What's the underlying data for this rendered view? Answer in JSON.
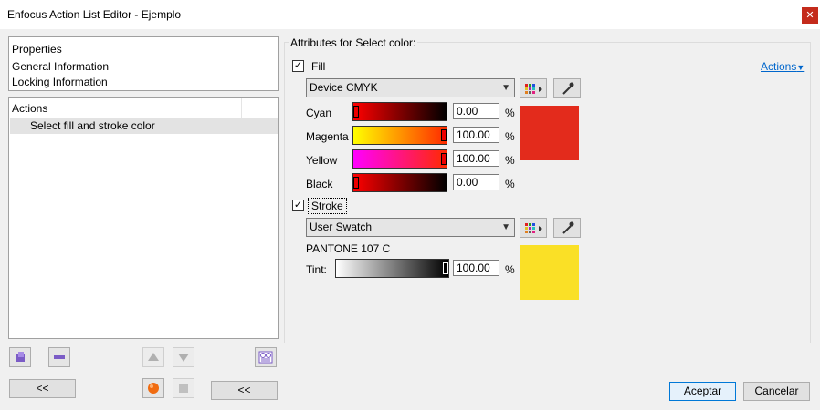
{
  "window": {
    "title": "Enfocus Action List Editor - Ejemplo",
    "close_icon": "close-icon"
  },
  "properties": {
    "header": "Properties",
    "items": [
      "General Information",
      "Locking Information"
    ]
  },
  "actions": {
    "header": "Actions",
    "items": [
      "Select fill and stroke color"
    ]
  },
  "buttons": {
    "back1": "<<",
    "back2": "<<",
    "ok": "Aceptar",
    "cancel": "Cancelar"
  },
  "attributes": {
    "group_title": "Attributes for Select color:",
    "actions_link": "Actions",
    "fill": {
      "label": "Fill",
      "checked": true,
      "color_space": "Device CMYK",
      "channels": [
        {
          "label": "Cyan",
          "value": "0.00",
          "unit": "%",
          "level": 0
        },
        {
          "label": "Magenta",
          "value": "100.00",
          "unit": "%",
          "level": 1
        },
        {
          "label": "Yellow",
          "value": "100.00",
          "unit": "%",
          "level": 1
        },
        {
          "label": "Black",
          "value": "0.00",
          "unit": "%",
          "level": 0
        }
      ],
      "swatch_color": "#e32b1c"
    },
    "stroke": {
      "label": "Stroke",
      "checked": true,
      "color_space": "User Swatch",
      "swatch_name": "PANTONE 107 C",
      "tint": {
        "label": "Tint:",
        "value": "100.00",
        "unit": "%",
        "level": 1
      },
      "swatch_color": "#fae026"
    }
  }
}
